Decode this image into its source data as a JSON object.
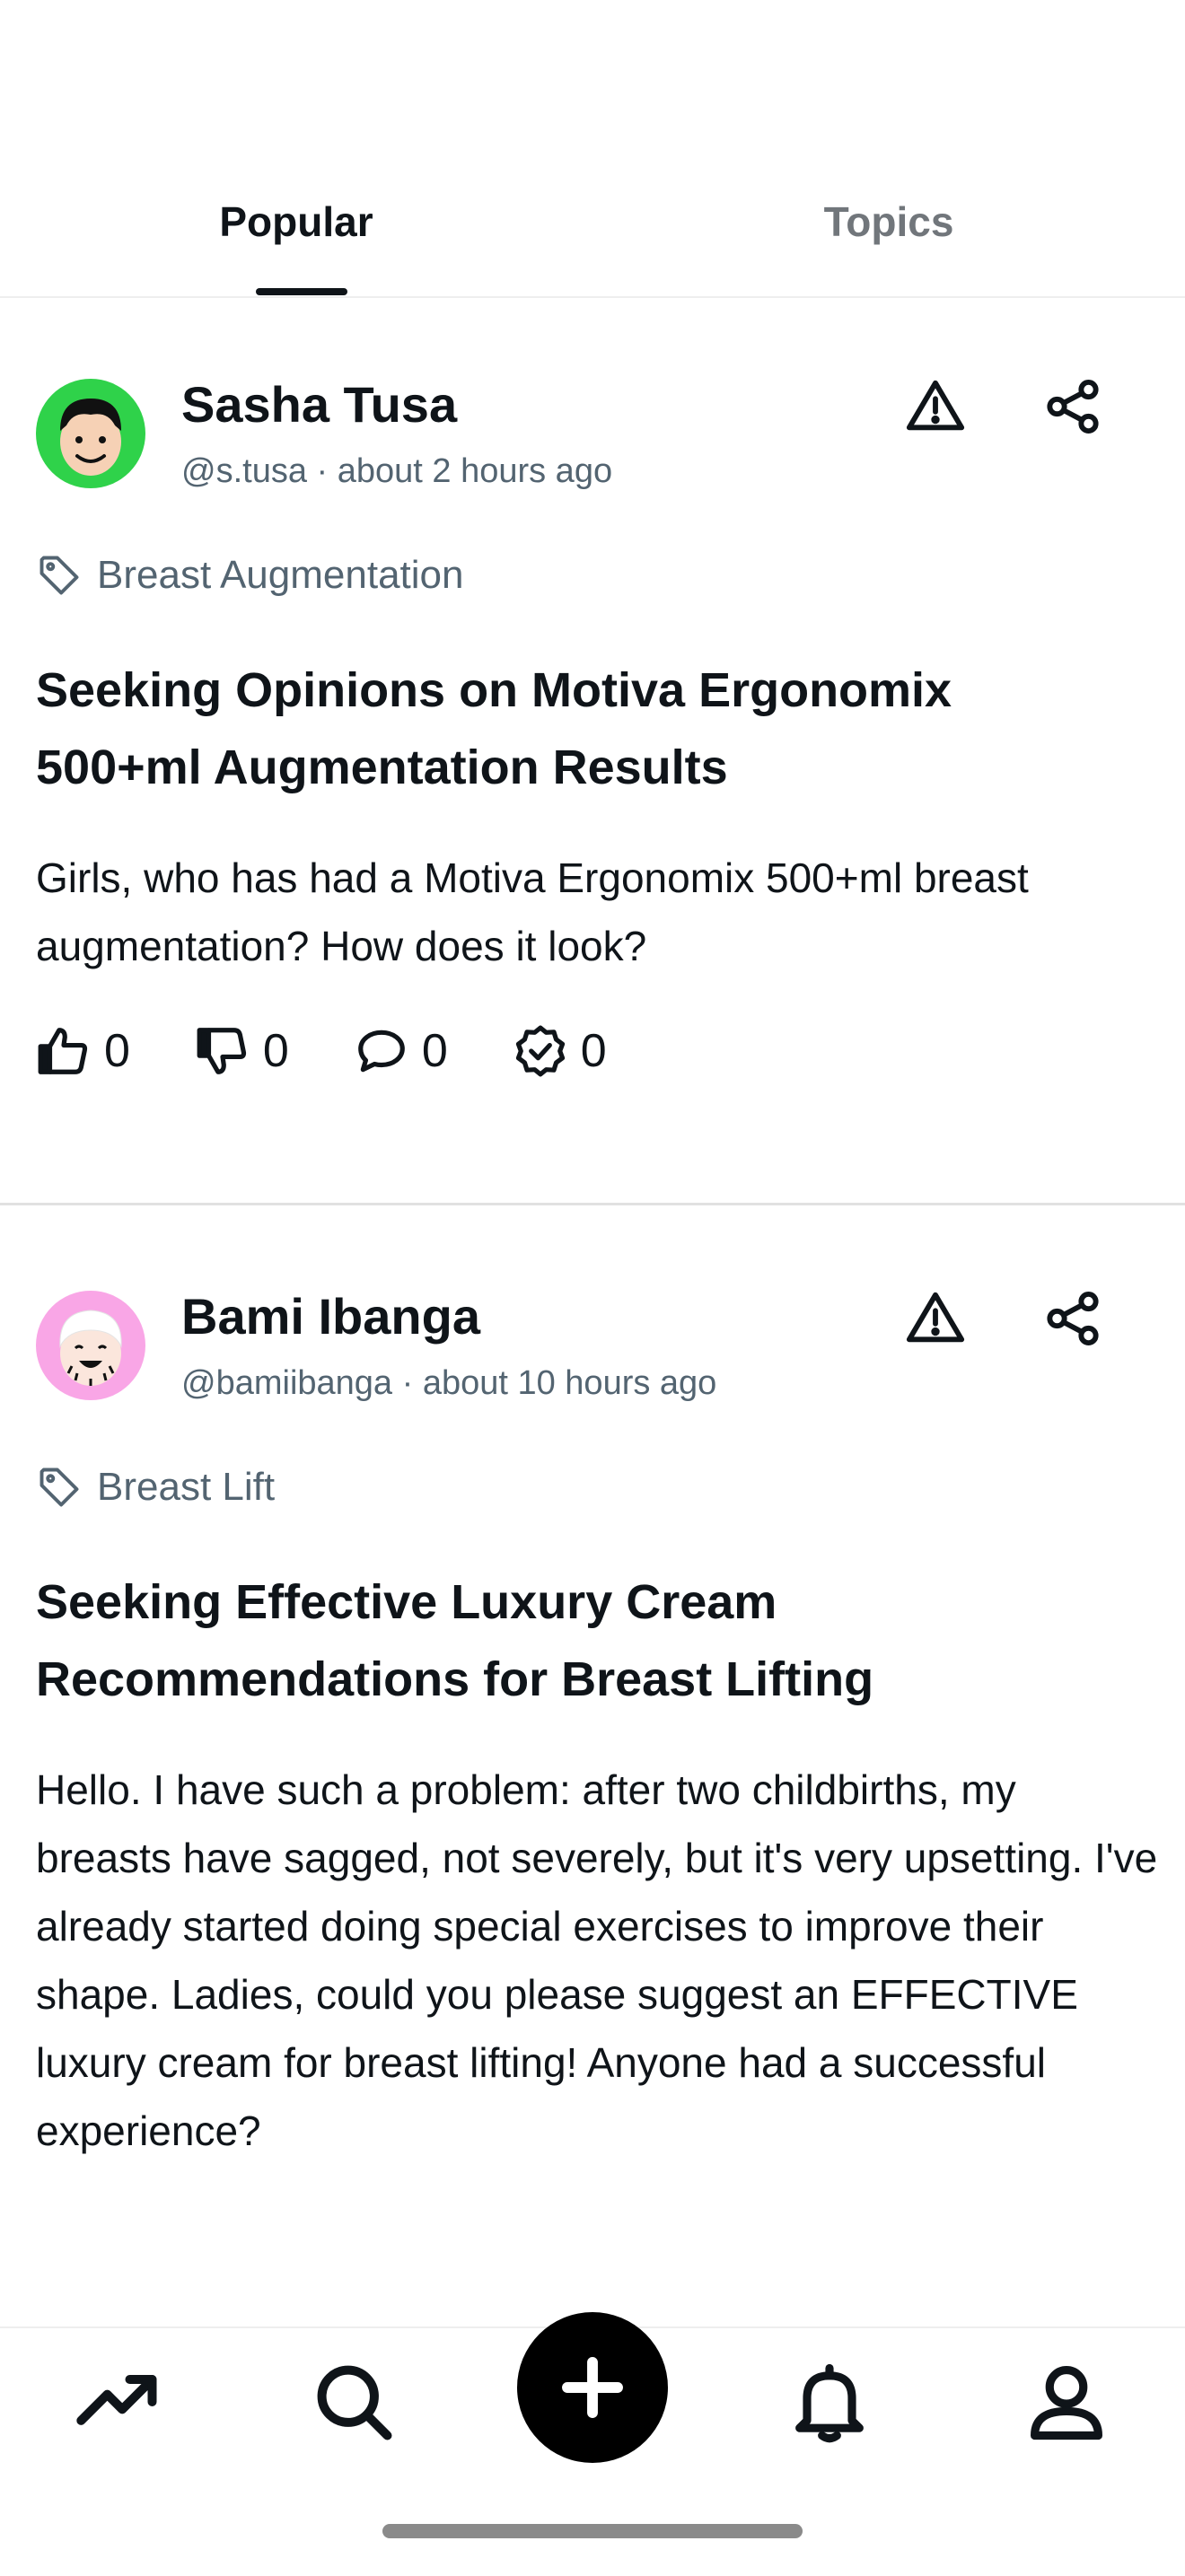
{
  "tabs": {
    "popular": "Popular",
    "topics": "Topics"
  },
  "posts": [
    {
      "author": "Sasha Tusa",
      "meta": "@s.tusa · about 2 hours ago",
      "tag": "Breast Augmentation",
      "title": "Seeking Opinions on Motiva Ergonomix 500+ml Augmentation Results",
      "body": "Girls, who has had a Motiva Ergonomix 500+ml breast augmentation? How does it look?",
      "likes": "0",
      "dislikes": "0",
      "comments": "0",
      "verified": "0",
      "avatar_color": "#2fd24a"
    },
    {
      "author": "Bami Ibanga",
      "meta": "@bamiibanga · about 10 hours ago",
      "tag": "Breast Lift",
      "title": "Seeking Effective Luxury Cream Recommendations for Breast Lifting",
      "body": "Hello. I have such a problem: after two childbirths, my breasts have sagged, not severely, but it's very upsetting. I've already started doing special exercises to improve their shape. Ladies, could you please suggest an EFFECTIVE luxury cream for breast lifting! Anyone had a successful experience?",
      "avatar_color": "#f9a6e6"
    }
  ],
  "nav": {
    "icons": [
      "trending-icon",
      "search-icon",
      "plus-icon",
      "bell-icon",
      "profile-icon"
    ]
  }
}
